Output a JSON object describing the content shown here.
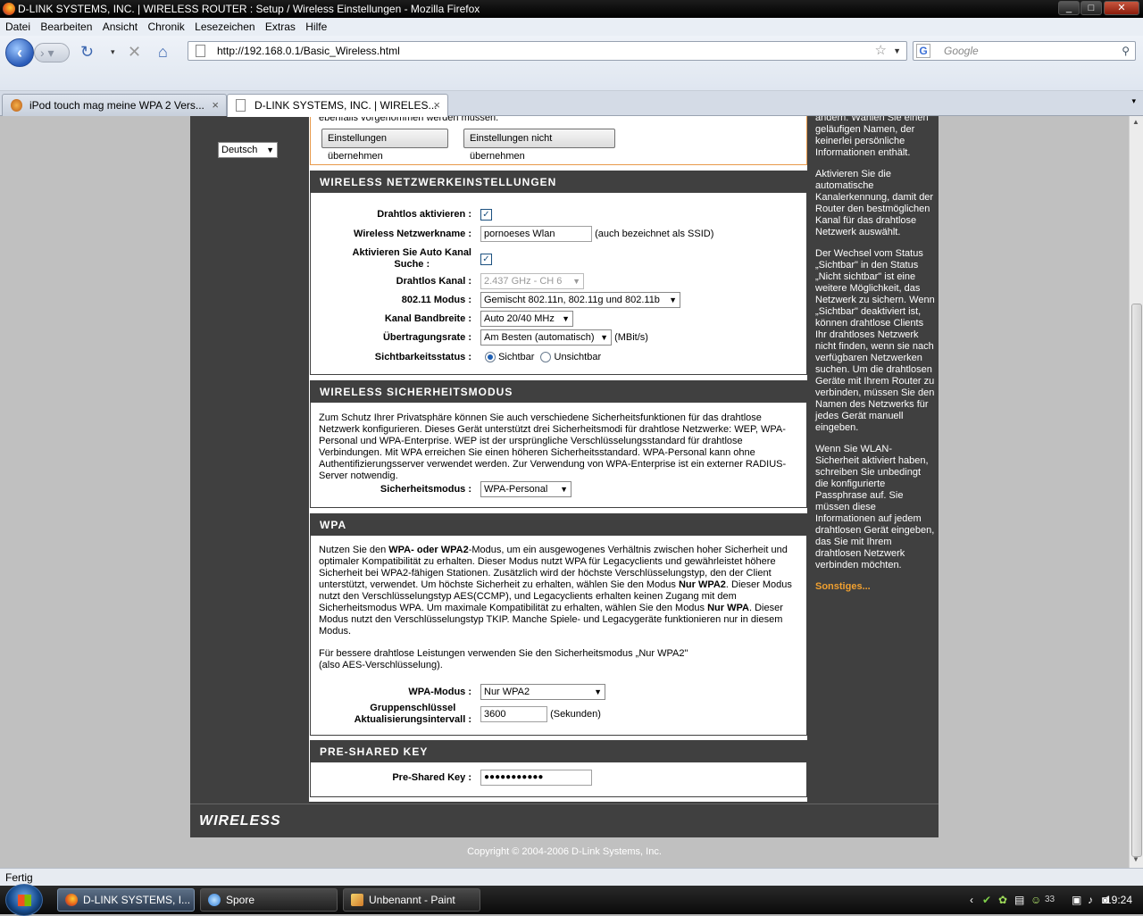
{
  "window": {
    "title": "D-LINK SYSTEMS, INC. | WIRELESS ROUTER : Setup / Wireless Einstellungen - Mozilla Firefox",
    "minimize": "_",
    "maximize": "□",
    "close": "✕"
  },
  "menu": [
    "Datei",
    "Bearbeiten",
    "Ansicht",
    "Chronik",
    "Lesezeichen",
    "Extras",
    "Hilfe"
  ],
  "nav": {
    "url": "http://192.168.0.1/Basic_Wireless.html",
    "search_placeholder": "Google"
  },
  "tabs": [
    {
      "label": "iPod touch mag meine WPA 2 Vers..."
    },
    {
      "label": "D-LINK SYSTEMS, INC. | WIRELES..."
    }
  ],
  "page": {
    "language": "Deutsch",
    "top_note": "ebenfalls vorgenommen werden müssen.",
    "buttons": {
      "apply": "Einstellungen übernehmen",
      "discard": "Einstellungen nicht übernehmen"
    },
    "wireless": {
      "heading": "WIRELESS NETZWERKEINSTELLUNGEN",
      "enable_label": "Drahtlos aktivieren :",
      "ssid_label": "Wireless Netzwerkname :",
      "ssid_value": "pornoeses Wlan",
      "ssid_note": "(auch bezeichnet als SSID)",
      "auto_channel_label_1": "Aktivieren Sie Auto Kanal",
      "auto_channel_label_2": "Suche :",
      "channel_label": "Drahtlos Kanal :",
      "channel_value": "2.437 GHz - CH 6",
      "mode_label": "802.11 Modus :",
      "mode_value": "Gemischt 802.11n, 802.11g und 802.11b",
      "bandwidth_label": "Kanal Bandbreite :",
      "bandwidth_value": "Auto 20/40 MHz",
      "rate_label": "Übertragungsrate :",
      "rate_value": "Am Besten (automatisch)",
      "rate_unit": "(MBit/s)",
      "visibility_label": "Sichtbarkeitsstatus :",
      "visible": "Sichtbar",
      "invisible": "Unsichtbar"
    },
    "security": {
      "heading": "WIRELESS SICHERHEITSMODUS",
      "text": "Zum Schutz Ihrer Privatsphäre können Sie auch verschiedene Sicherheitsfunktionen für das drahtlose Netzwerk konfigurieren. Dieses Gerät unterstützt drei Sicherheitsmodi für drahtlose Netzwerke: WEP, WPA-Personal und WPA-Enterprise. WEP ist der ursprüngliche Verschlüsselungsstandard für drahtlose Verbindungen. Mit WPA erreichen Sie einen höheren Sicherheitsstandard. WPA-Personal kann ohne Authentifizierungsserver verwendet werden. Zur Verwendung von WPA-Enterprise ist ein externer RADIUS-Server notwendig.",
      "mode_label": "Sicherheitsmodus :",
      "mode_value": "WPA-Personal"
    },
    "wpa": {
      "heading": "WPA",
      "p1_a": "Nutzen Sie den ",
      "p1_b": "WPA- oder WPA2",
      "p1_c": "-Modus, um ein ausgewogenes Verhältnis zwischen hoher Sicherheit und optimaler Kompatibilität zu erhalten. Dieser Modus nutzt WPA für Legacyclients und gewährleistet höhere Sicherheit bei WPA2-fähigen Stationen. Zusätzlich wird der höchste Verschlüsselungstyp, den der Client unterstützt, verwendet. Um höchste Sicherheit zu erhalten, wählen Sie den Modus ",
      "p1_d": "Nur WPA2",
      "p1_e": ". Dieser Modus nutzt den Verschlüsselungstyp AES(CCMP), und Legacyclients erhalten keinen Zugang mit dem Sicherheitsmodus WPA. Um maximale Kompatibilität zu erhalten, wählen Sie den Modus ",
      "p1_f": "Nur WPA",
      "p1_g": ". Dieser Modus nutzt den Verschlüsselungstyp TKIP. Manche Spiele- und Legacygeräte funktionieren nur in diesem Modus.",
      "p2": "Für bessere drahtlose Leistungen verwenden Sie den Sicherheitsmodus „Nur WPA2\" (also AES-Verschlüsselung).",
      "mode_label": "WPA-Modus :",
      "mode_value": "Nur WPA2",
      "group_label_1": "Gruppenschlüssel",
      "group_label_2": "Aktualisierungsintervall :",
      "group_value": "3600",
      "group_unit": "(Sekunden)"
    },
    "psk": {
      "heading": "PRE-SHARED KEY",
      "label": "Pre-Shared Key :",
      "value": "●●●●●●●●●●●"
    },
    "help": {
      "p0": "ändern. Wählen Sie einen geläufigen Namen, der keinerlei persönliche Informationen enthält.",
      "p1": "Aktivieren Sie die automatische Kanalerkennung, damit der Router den bestmöglichen Kanal für das drahtlose Netzwerk auswählt.",
      "p2": "Der Wechsel vom Status „Sichtbar\" in den Status „Nicht sichtbar\" ist eine weitere Möglichkeit, das Netzwerk zu sichern. Wenn „Sichtbar\" deaktiviert ist, können drahtlose Clients Ihr drahtloses Netzwerk nicht finden, wenn sie nach verfügbaren Netzwerken suchen. Um die drahtlosen Geräte mit Ihrem Router zu verbinden, müssen Sie den Namen des Netzwerks für jedes Gerät manuell eingeben.",
      "p3": "Wenn Sie WLAN-Sicherheit aktiviert haben, schreiben Sie unbedingt die konfigurierte Passphrase auf. Sie müssen diese Informationen auf jedem drahtlosen Gerät eingeben, das Sie mit Ihrem drahtlosen Netzwerk verbinden möchten.",
      "more": "Sonstiges..."
    },
    "footer_logo": "WIRELESS",
    "copyright": "Copyright © 2004-2006 D-Link Systems, Inc."
  },
  "status": "Fertig",
  "taskbar": {
    "items": [
      "D-LINK SYSTEMS, I...",
      "Spore",
      "Unbenannt - Paint"
    ],
    "clock": "19:24",
    "tray_count": "33"
  }
}
